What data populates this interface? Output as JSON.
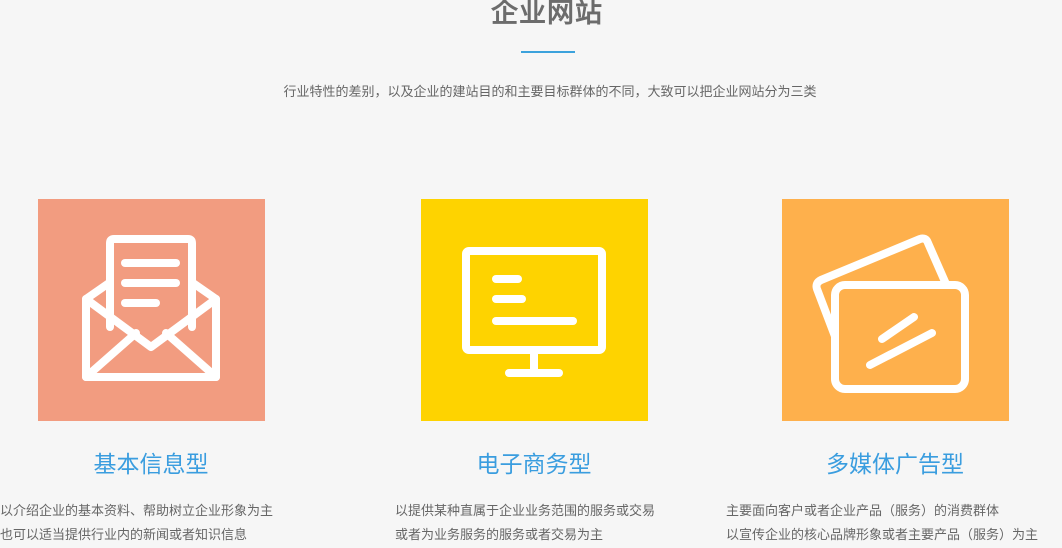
{
  "section": {
    "title": "企业网站",
    "subtitle": "行业特性的差别，以及企业的建站目的和主要目标群体的不同，大致可以把企业网站分为三类"
  },
  "colors": {
    "accent_line": "#3ca2dc",
    "title_blue": "#3a9ddf",
    "card1_bg": "#f29c80",
    "card2_bg": "#fed300",
    "card3_bg": "#feb04c"
  },
  "cards": [
    {
      "icon": "envelope-letter-icon",
      "title": "基本信息型",
      "lines": [
        "以介绍企业的基本资料、帮助树立企业形象为主",
        "也可以适当提供行业内的新闻或者知识信息"
      ]
    },
    {
      "icon": "monitor-icon",
      "title": "电子商务型",
      "lines": [
        "以提供某种直属于企业业务范围的服务或交易",
        "或者为业务服务的服务或者交易为主"
      ]
    },
    {
      "icon": "cards-icon",
      "title": "多媒体广告型",
      "lines": [
        "主要面向客户或者企业产品（服务）的消费群体",
        "以宣传企业的核心品牌形象或者主要产品（服务）为主"
      ]
    }
  ]
}
